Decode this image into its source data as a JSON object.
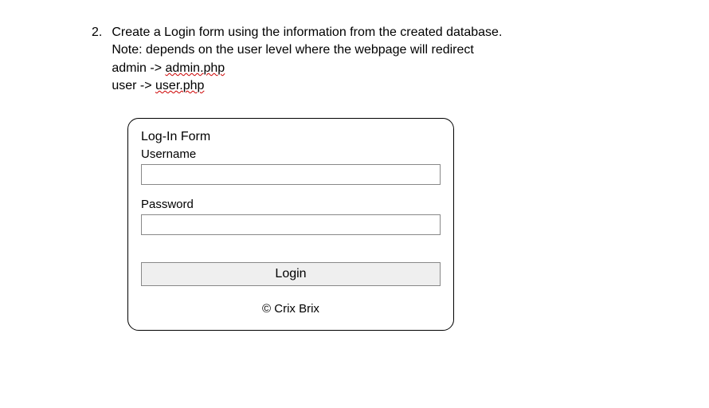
{
  "question": {
    "number": "2.",
    "line1": "Create a Login form using the information from the created database.",
    "line2": "Note: depends on the user level where the webpage will redirect",
    "line3_pre": "admin -> ",
    "line3_link": "admin.php",
    "line4_pre": "user -> ",
    "line4_link": "user.php"
  },
  "form": {
    "title": "Log-In Form",
    "username_label": "Username",
    "password_label": "Password",
    "login_button": "Login",
    "copyright": "© Crix Brix"
  }
}
